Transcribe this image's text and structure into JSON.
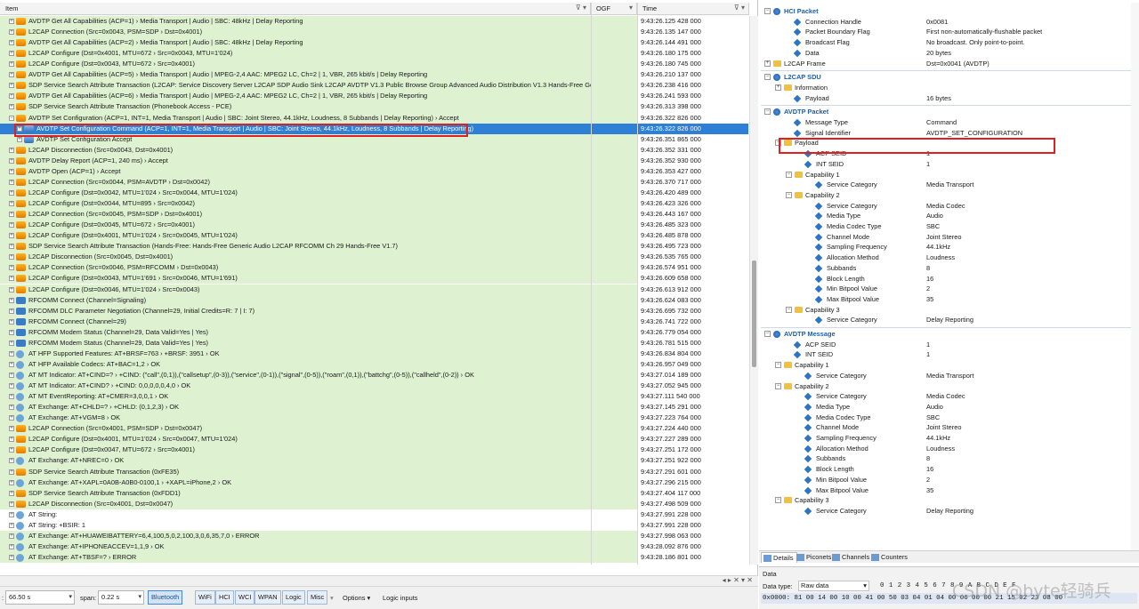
{
  "columns": {
    "item": "Item",
    "ogf": "OGF",
    "time": "Time"
  },
  "rows": [
    {
      "text": "AVDTP Get All Capabilities (ACP=1) › Media Transport | Audio | SBC: 48kHz | Delay Reporting",
      "time": "9:43:26.125 428 000",
      "bg": "green",
      "icon": "pc",
      "indent": 0
    },
    {
      "text": "L2CAP Connection (Src=0x0043, PSM=SDP › Dst=0x4001)",
      "time": "9:43:26.135 147 000",
      "bg": "green",
      "icon": "pc",
      "indent": 0
    },
    {
      "text": "AVDTP Get All Capabilities (ACP=2) › Media Transport | Audio | SBC: 48kHz | Delay Reporting",
      "time": "9:43:26.144 491 000",
      "bg": "green",
      "icon": "pc",
      "indent": 0
    },
    {
      "text": "L2CAP Configure (Dst=0x4001, MTU=672 › Src=0x0043, MTU=1'024)",
      "time": "9:43:26.180 175 000",
      "bg": "green",
      "icon": "pc",
      "indent": 0
    },
    {
      "text": "L2CAP Configure (Dst=0x0043, MTU=672 › Src=0x4001)",
      "time": "9:43:26.180 745 000",
      "bg": "green",
      "icon": "pc",
      "indent": 0
    },
    {
      "text": "AVDTP Get All Capabilities (ACP=5) › Media Transport | Audio | MPEG-2,4 AAC: MPEG2 LC, Ch=2 | 1, VBR, 265 kbit/s | Delay Reporting",
      "time": "9:43:26.210 137 000",
      "bg": "green",
      "icon": "pc",
      "indent": 0
    },
    {
      "text": "SDP Service Search Attribute Transaction (L2CAP: Service Discovery Server L2CAP SDP Audio Sink L2CAP AVDTP V1.3 Public Browse Group Advanced Audio Distribution V1.3 Hands-Free Generic Audio...",
      "time": "9:43:26.238 416 000",
      "bg": "green",
      "icon": "pc",
      "indent": 0
    },
    {
      "text": "AVDTP Get All Capabilities (ACP=6) › Media Transport | Audio | MPEG-2,4 AAC: MPEG2 LC, Ch=2 | 1, VBR, 265 kbit/s | Delay Reporting",
      "time": "9:43:26.241 593 000",
      "bg": "green",
      "icon": "pc",
      "indent": 0
    },
    {
      "text": "SDP Service Search Attribute Transaction (Phonebook Access - PCE)",
      "time": "9:43:26.313 398 000",
      "bg": "green",
      "icon": "pc",
      "indent": 0
    },
    {
      "text": "AVDTP Set Configuration (ACP=1, INT=1, Media Transport | Audio | SBC: Joint Stereo, 44.1kHz, Loudness, 8 Subbands | Delay Reporting) › Accept",
      "time": "9:43:26.322 826 000",
      "bg": "green",
      "icon": "pc",
      "indent": 0,
      "expanded": true
    },
    {
      "text": "AVDTP Set Configuration Command (ACP=1, INT=1, Media Transport | Audio | SBC: Joint Stereo, 44.1kHz, Loudness, 8 Subbands | Delay Reporting)",
      "time": "9:43:26.322 826 000",
      "bg": "sel",
      "icon": "pc2",
      "indent": 1
    },
    {
      "text": "AVDTP Set Configuration Accept",
      "time": "9:43:26.351 865 000",
      "bg": "green",
      "icon": "pc2",
      "indent": 1
    },
    {
      "text": "L2CAP Disconnection (Src=0x0043, Dst=0x4001)",
      "time": "9:43:26.352 331 000",
      "bg": "green",
      "icon": "pc",
      "indent": 0
    },
    {
      "text": "AVDTP Delay Report (ACP=1, 240 ms) › Accept",
      "time": "9:43:26.352 930 000",
      "bg": "green",
      "icon": "pc",
      "indent": 0
    },
    {
      "text": "AVDTP Open (ACP=1) › Accept",
      "time": "9:43:26.353 427 000",
      "bg": "green",
      "icon": "pc",
      "indent": 0
    },
    {
      "text": "L2CAP Connection (Src=0x0044, PSM=AVDTP › Dst=0x0042)",
      "time": "9:43:26.370 717 000",
      "bg": "green",
      "icon": "pc",
      "indent": 0
    },
    {
      "text": "L2CAP Configure (Dst=0x0042, MTU=1'024 › Src=0x0044, MTU=1'024)",
      "time": "9:43:26.420 489 000",
      "bg": "green",
      "icon": "pc",
      "indent": 0
    },
    {
      "text": "L2CAP Configure (Dst=0x0044, MTU=895 › Src=0x0042)",
      "time": "9:43:26.423 326 000",
      "bg": "green",
      "icon": "pc",
      "indent": 0
    },
    {
      "text": "L2CAP Connection (Src=0x0045, PSM=SDP › Dst=0x4001)",
      "time": "9:43:26.443 167 000",
      "bg": "green",
      "icon": "pc",
      "indent": 0
    },
    {
      "text": "L2CAP Configure (Dst=0x0045, MTU=672 › Src=0x4001)",
      "time": "9:43:26.485 323 000",
      "bg": "green",
      "icon": "pc",
      "indent": 0
    },
    {
      "text": "L2CAP Configure (Dst=0x4001, MTU=1'024 › Src=0x0045, MTU=1'024)",
      "time": "9:43:26.485 878 000",
      "bg": "green",
      "icon": "pc",
      "indent": 0
    },
    {
      "text": "SDP Service Search Attribute Transaction (Hands-Free: Hands-Free Generic Audio L2CAP RFCOMM Ch 29 Hands-Free V1.7)",
      "time": "9:43:26.495 723 000",
      "bg": "green",
      "icon": "pc",
      "indent": 0
    },
    {
      "text": "L2CAP Disconnection (Src=0x0045, Dst=0x4001)",
      "time": "9:43:26.535 765 000",
      "bg": "green",
      "icon": "pc",
      "indent": 0
    },
    {
      "text": "L2CAP Connection (Src=0x0046, PSM=RFCOMM › Dst=0x0043)",
      "time": "9:43:26.574 951 000",
      "bg": "green",
      "icon": "pc",
      "indent": 0
    },
    {
      "text": "L2CAP Configure (Dst=0x0043, MTU=1'691 › Src=0x0046, MTU=1'691)",
      "time": "9:43:26.609 658 000",
      "bg": "green",
      "icon": "pc",
      "indent": 0
    },
    {
      "text": "L2CAP Configure (Dst=0x0046, MTU=1'024 › Src=0x0043)",
      "time": "9:43:26.613 912 000",
      "bg": "green",
      "icon": "pc",
      "indent": 0
    },
    {
      "text": "RFCOMM Connect (Channel=Signaling)",
      "time": "9:43:26.624 083 000",
      "bg": "green",
      "icon": "rf",
      "indent": 0
    },
    {
      "text": "RFCOMM DLC Parameter Negotiation (Channel=29, Initial Credits=R: 7 | I: 7)",
      "time": "9:43:26.695 732 000",
      "bg": "green",
      "icon": "rf",
      "indent": 0
    },
    {
      "text": "RFCOMM Connect (Channel=29)",
      "time": "9:43:26.741 722 000",
      "bg": "green",
      "icon": "rf",
      "indent": 0
    },
    {
      "text": "RFCOMM Modem Status (Channel=29, Data Valid=Yes | Yes)",
      "time": "9:43:26.779 054 000",
      "bg": "green",
      "icon": "rf",
      "indent": 0
    },
    {
      "text": "RFCOMM Modem Status (Channel=29, Data Valid=Yes | Yes)",
      "time": "9:43:26.781 515 000",
      "bg": "green",
      "icon": "rf",
      "indent": 0
    },
    {
      "text": "AT HFP Supported Features: AT+BRSF=763 › +BRSF: 3951 › OK",
      "time": "9:43:26.834 804 000",
      "bg": "green",
      "icon": "at",
      "indent": 0
    },
    {
      "text": "AT HFP Available Codecs: AT+BAC=1,2 › OK",
      "time": "9:43:26.957 049 000",
      "bg": "green",
      "icon": "at",
      "indent": 0
    },
    {
      "text": "AT MT Indicator: AT+CIND=? › +CIND: (\"call\",(0,1)),(\"callsetup\",(0-3)),(\"service\",(0-1)),(\"signal\",(0-5)),(\"roam\",(0,1)),(\"battchg\",(0-5)),(\"callheld\",(0-2)) › OK",
      "time": "9:43:27.014 189 000",
      "bg": "green",
      "icon": "at",
      "indent": 0
    },
    {
      "text": "AT MT Indicator: AT+CIND? › +CIND: 0,0,0,0,0,4,0 › OK",
      "time": "9:43:27.052 945 000",
      "bg": "green",
      "icon": "at",
      "indent": 0
    },
    {
      "text": "AT MT EventReporting: AT+CMER=3,0,0,1 › OK",
      "time": "9:43:27.111 540 000",
      "bg": "green",
      "icon": "at",
      "indent": 0
    },
    {
      "text": "AT Exchange: AT+CHLD=? › +CHLD: (0,1,2,3) › OK",
      "time": "9:43:27.145 291 000",
      "bg": "green",
      "icon": "at",
      "indent": 0
    },
    {
      "text": "AT Exchange: AT+VGM=8 › OK",
      "time": "9:43:27.223 764 000",
      "bg": "green",
      "icon": "at",
      "indent": 0
    },
    {
      "text": "L2CAP Connection (Src=0x4001, PSM=SDP › Dst=0x0047)",
      "time": "9:43:27.224 440 000",
      "bg": "green",
      "icon": "pc",
      "indent": 0
    },
    {
      "text": "L2CAP Configure (Dst=0x4001, MTU=1'024 › Src=0x0047, MTU=1'024)",
      "time": "9:43:27.227 289 000",
      "bg": "green",
      "icon": "pc",
      "indent": 0
    },
    {
      "text": "L2CAP Configure (Dst=0x0047, MTU=672 › Src=0x4001)",
      "time": "9:43:27.251 172 000",
      "bg": "green",
      "icon": "pc",
      "indent": 0
    },
    {
      "text": "AT Exchange: AT+NREC=0 › OK",
      "time": "9:43:27.251 922 000",
      "bg": "green",
      "icon": "at",
      "indent": 0
    },
    {
      "text": "SDP Service Search Attribute Transaction (0xFE35)",
      "time": "9:43:27.291 601 000",
      "bg": "green",
      "icon": "pc",
      "indent": 0
    },
    {
      "text": "AT Exchange: AT+XAPL=0A0B-A0B0-0100,1 › +XAPL=iPhone,2 › OK",
      "time": "9:43:27.296 215 000",
      "bg": "green",
      "icon": "at",
      "indent": 0
    },
    {
      "text": "SDP Service Search Attribute Transaction (0xFDD1)",
      "time": "9:43:27.404 117 000",
      "bg": "green",
      "icon": "pc",
      "indent": 0
    },
    {
      "text": "L2CAP Disconnection (Src=0x4001, Dst=0x0047)",
      "time": "9:43:27.498 509 000",
      "bg": "green",
      "icon": "pc",
      "indent": 0
    },
    {
      "text": "AT String:",
      "time": "9:43:27.991 228 000",
      "bg": "white",
      "icon": "at",
      "indent": 0
    },
    {
      "text": "AT String: +BSIR: 1",
      "time": "9:43:27.991 228 000",
      "bg": "white",
      "icon": "at",
      "indent": 0
    },
    {
      "text": "AT Exchange: AT+HUAWEIBATTERY=6,4,100,5,0,2,100,3,0,6,35,7,0 › ERROR",
      "time": "9:43:27.998 063 000",
      "bg": "green",
      "icon": "at",
      "indent": 0
    },
    {
      "text": "AT Exchange: AT+IPHONEACCEV=1,1,9 › OK",
      "time": "9:43:28.092 876 000",
      "bg": "green",
      "icon": "at",
      "indent": 0
    },
    {
      "text": "AT Exchange: AT+TBSF=? › ERROR",
      "time": "9:43:28.186 801 000",
      "bg": "green",
      "icon": "at",
      "indent": 0
    }
  ],
  "toolbar": {
    "position": "66.50 s",
    "span_label": "span:",
    "span_value": "0.22 s",
    "filters": [
      "Bluetooth",
      "WiFi",
      "HCI",
      "WCI",
      "WPAN",
      "Logic",
      "Misc"
    ],
    "options_label": "Options",
    "logic_inputs_label": "Logic inputs"
  },
  "details": [
    {
      "type": "section",
      "label": "HCI Packet",
      "indent": 0
    },
    {
      "type": "field",
      "label": "Connection Handle",
      "value": "0x0081",
      "indent": 1
    },
    {
      "type": "field",
      "label": "Packet Boundary Flag",
      "value": "First non-automatically-flushable packet",
      "indent": 1
    },
    {
      "type": "field",
      "label": "Broadcast Flag",
      "value": "No broadcast. Only point-to-point.",
      "indent": 1
    },
    {
      "type": "field",
      "label": "Data",
      "value": "20 bytes",
      "indent": 1
    },
    {
      "type": "group",
      "label": "L2CAP Frame",
      "value": "Dst=0x0041 (AVDTP)",
      "indent": 0,
      "collapsed": true
    },
    {
      "type": "section",
      "label": "L2CAP SDU",
      "indent": 0
    },
    {
      "type": "group",
      "label": "Information",
      "value": "",
      "indent": 1,
      "collapsed": true
    },
    {
      "type": "field",
      "label": "Payload",
      "value": "16 bytes",
      "indent": 1
    },
    {
      "type": "section",
      "label": "AVDTP Packet",
      "indent": 0
    },
    {
      "type": "field",
      "label": "Message Type",
      "value": "Command",
      "indent": 1
    },
    {
      "type": "field",
      "label": "Signal Identifier",
      "value": "AVDTP_SET_CONFIGURATION",
      "indent": 1
    },
    {
      "type": "group",
      "label": "Payload",
      "value": "",
      "indent": 1,
      "collapsed": false
    },
    {
      "type": "field",
      "label": "ACP SEID",
      "value": "1",
      "indent": 2
    },
    {
      "type": "field",
      "label": "INT SEID",
      "value": "1",
      "indent": 2
    },
    {
      "type": "group",
      "label": "Capability 1",
      "value": "",
      "indent": 2,
      "collapsed": false
    },
    {
      "type": "field",
      "label": "Service Category",
      "value": "Media Transport",
      "indent": 3
    },
    {
      "type": "group",
      "label": "Capability 2",
      "value": "",
      "indent": 2,
      "collapsed": false
    },
    {
      "type": "field",
      "label": "Service Category",
      "value": "Media Codec",
      "indent": 3
    },
    {
      "type": "field",
      "label": "Media Type",
      "value": "Audio",
      "indent": 3
    },
    {
      "type": "field",
      "label": "Media Codec Type",
      "value": "SBC",
      "indent": 3
    },
    {
      "type": "field",
      "label": "Channel Mode",
      "value": "Joint Stereo",
      "indent": 3
    },
    {
      "type": "field",
      "label": "Sampling Frequency",
      "value": "44.1kHz",
      "indent": 3
    },
    {
      "type": "field",
      "label": "Allocation Method",
      "value": "Loudness",
      "indent": 3
    },
    {
      "type": "field",
      "label": "Subbands",
      "value": "8",
      "indent": 3
    },
    {
      "type": "field",
      "label": "Block Length",
      "value": "16",
      "indent": 3
    },
    {
      "type": "field",
      "label": "Min Bitpool Value",
      "value": "2",
      "indent": 3
    },
    {
      "type": "field",
      "label": "Max Bitpool Value",
      "value": "35",
      "indent": 3
    },
    {
      "type": "group",
      "label": "Capability 3",
      "value": "",
      "indent": 2,
      "collapsed": false
    },
    {
      "type": "field",
      "label": "Service Category",
      "value": "Delay Reporting",
      "indent": 3
    },
    {
      "type": "section",
      "label": "AVDTP Message",
      "indent": 0
    },
    {
      "type": "field",
      "label": "ACP SEID",
      "value": "1",
      "indent": 1
    },
    {
      "type": "field",
      "label": "INT SEID",
      "value": "1",
      "indent": 1
    },
    {
      "type": "group",
      "label": "Capability 1",
      "value": "",
      "indent": 1,
      "collapsed": false
    },
    {
      "type": "field",
      "label": "Service Category",
      "value": "Media Transport",
      "indent": 2
    },
    {
      "type": "group",
      "label": "Capability 2",
      "value": "",
      "indent": 1,
      "collapsed": false
    },
    {
      "type": "field",
      "label": "Service Category",
      "value": "Media Codec",
      "indent": 2
    },
    {
      "type": "field",
      "label": "Media Type",
      "value": "Audio",
      "indent": 2
    },
    {
      "type": "field",
      "label": "Media Codec Type",
      "value": "SBC",
      "indent": 2
    },
    {
      "type": "field",
      "label": "Channel Mode",
      "value": "Joint Stereo",
      "indent": 2
    },
    {
      "type": "field",
      "label": "Sampling Frequency",
      "value": "44.1kHz",
      "indent": 2
    },
    {
      "type": "field",
      "label": "Allocation Method",
      "value": "Loudness",
      "indent": 2
    },
    {
      "type": "field",
      "label": "Subbands",
      "value": "8",
      "indent": 2
    },
    {
      "type": "field",
      "label": "Block Length",
      "value": "16",
      "indent": 2
    },
    {
      "type": "field",
      "label": "Min Bitpool Value",
      "value": "2",
      "indent": 2
    },
    {
      "type": "field",
      "label": "Max Bitpool Value",
      "value": "35",
      "indent": 2
    },
    {
      "type": "group",
      "label": "Capability 3",
      "value": "",
      "indent": 1,
      "collapsed": false
    },
    {
      "type": "field",
      "label": "Service Category",
      "value": "Delay Reporting",
      "indent": 2
    }
  ],
  "detail_tabs": [
    "Details",
    "Piconets",
    "Channels",
    "Counters"
  ],
  "data_panel": {
    "title": "Data",
    "type_label": "Data type:",
    "type_value": "Raw data",
    "hex_header": "0  1  2  3  4  5  6  7  8  9  A  B  C  D  E  F",
    "hex_row": "0x0000: 81 00 14 00 10 00 41 00 50 03 04 01 04 00 06 00 00 21 15 02 23 08 00"
  },
  "watermark": "CSDN @byte轻骑兵",
  "colors": {
    "selection": "#2e7fd6",
    "row_green": "#def1d0",
    "section_blue": "#1c5fa8",
    "highlight_box": "#e02020"
  }
}
